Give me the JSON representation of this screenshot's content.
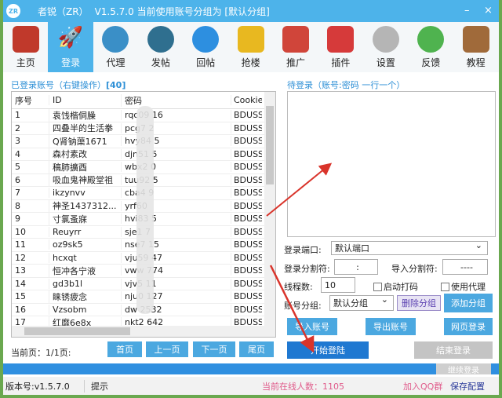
{
  "title": {
    "logo": "ZR",
    "app": "者锐（ZR）",
    "version_text": "V1.5.7.0  当前使用账号分组为  [默认分组]",
    "minimize": "–",
    "close": "×"
  },
  "toolbar": [
    {
      "label": "主页",
      "icon": "home-icon",
      "color": "#c0392b"
    },
    {
      "label": "登录",
      "icon": "rocket-icon",
      "color": "#ffffff"
    },
    {
      "label": "代理",
      "icon": "globe-icon",
      "color": "#3a8fc7"
    },
    {
      "label": "发帖",
      "icon": "clock-icon",
      "color": "#2f6f8f"
    },
    {
      "label": "回帖",
      "icon": "refresh-icon",
      "color": "#2d8fe0"
    },
    {
      "label": "抢楼",
      "icon": "bar-chart-icon",
      "color": "#e8b820"
    },
    {
      "label": "推广",
      "icon": "map-pin-icon",
      "color": "#d0453a"
    },
    {
      "label": "插件",
      "icon": "gift-icon",
      "color": "#d63a3a"
    },
    {
      "label": "设置",
      "icon": "gear-icon",
      "color": "#b5b5b5"
    },
    {
      "label": "反馈",
      "icon": "check-icon",
      "color": "#4fb34f"
    },
    {
      "label": "教程",
      "icon": "book-icon",
      "color": "#a06a3a"
    }
  ],
  "logged": {
    "label": "已登录账号（右键操作）",
    "count": "[40]",
    "headers": [
      "序号",
      "ID",
      "密码",
      "Cookie"
    ],
    "rows": [
      [
        "1",
        "袁饯楷侗臊",
        "rqc09   16",
        "BDUSS="
      ],
      [
        "2",
        "四叠半的生活拳",
        "pcg7   2",
        "BDUSS="
      ],
      [
        "3",
        "Q肾钠蕖1671",
        "hvy84   5",
        "BDUSS="
      ],
      [
        "4",
        "森村素改",
        "djn51   5",
        "BDUSS="
      ],
      [
        "5",
        "稿肺擴酉",
        "wbx2   0",
        "BDUSS="
      ],
      [
        "6",
        "吸血鬼神殿堂祖",
        "tuu92   5",
        "BDUSS="
      ],
      [
        "7",
        "ikzynvv",
        "cba4   9",
        "BDUSS="
      ],
      [
        "8",
        "神圣1437312...",
        "yrf60",
        "BDUSS="
      ],
      [
        "9",
        "寸氯蚤寐",
        "hvi83   5",
        "BDUSS="
      ],
      [
        "10",
        "Reuyrr",
        "sje1   7",
        "BDUSS="
      ],
      [
        "11",
        "oz9sk5",
        "nse7   15",
        "BDUSS="
      ],
      [
        "12",
        "hcxqt",
        "vju59   47",
        "BDUSS="
      ],
      [
        "13",
        "恒冲各宁液",
        "vww   774",
        "BDUSS="
      ],
      [
        "14",
        "gd3b1l",
        "vjv5   11",
        "BDUSS="
      ],
      [
        "15",
        "睐锈疲念",
        "nju0   127",
        "BDUSS="
      ],
      [
        "16",
        "Vzsobm",
        "dw   2532",
        "BDUSS="
      ],
      [
        "17",
        "红靡6e8x",
        "nkt2   642",
        "BDUSS="
      ]
    ]
  },
  "pager": {
    "current": "当前页：1/1页:",
    "first": "首页",
    "prev": "上一页",
    "next": "下一页",
    "last": "尾页"
  },
  "pending": {
    "label": "待登录（账号:密码 一行一个）",
    "value": ""
  },
  "form": {
    "port_label": "登录端口:",
    "port_value": "默认端口",
    "login_sep_label": "登录分割符:",
    "login_sep": ":",
    "import_sep_label": "导入分割符:",
    "import_sep": "----",
    "threads_label": "线程数:",
    "threads": "10",
    "captcha": "启动打码",
    "proxy": "使用代理",
    "group_label": "账号分组:",
    "group_value": "默认分组",
    "delete_group": "删除分组",
    "add_group": "添加分组",
    "import": "导入账号",
    "export": "导出账号",
    "web_login": "网页登录",
    "start": "开始登陆",
    "stop": "结束登录",
    "continue": "继续登录"
  },
  "status": {
    "version": "版本号:v1.5.7.0",
    "hint": "提示",
    "online": "当前在线人数：1105",
    "qq": "加入QQ群",
    "save": "保存配置"
  }
}
